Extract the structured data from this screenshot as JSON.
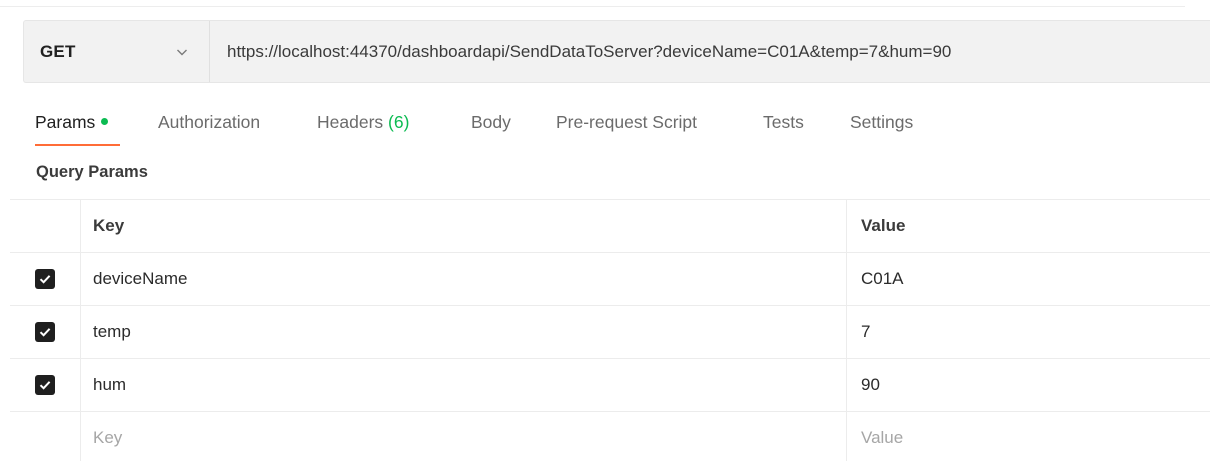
{
  "request": {
    "method": "GET",
    "url": "https://localhost:44370/dashboardapi/SendDataToServer?deviceName=C01A&temp=7&hum=90"
  },
  "tabs": [
    {
      "label": "Params",
      "active": true,
      "indicator": "green-dot"
    },
    {
      "label": "Authorization"
    },
    {
      "label": "Headers",
      "count": "(6)"
    },
    {
      "label": "Body"
    },
    {
      "label": "Pre-request Script"
    },
    {
      "label": "Tests"
    },
    {
      "label": "Settings"
    }
  ],
  "query_params": {
    "title": "Query Params",
    "columns": {
      "key": "Key",
      "value": "Value"
    },
    "rows": [
      {
        "key": "deviceName",
        "value": "C01A",
        "checked": true
      },
      {
        "key": "temp",
        "value": "7",
        "checked": true
      },
      {
        "key": "hum",
        "value": "90",
        "checked": true
      }
    ],
    "placeholder": {
      "key": "Key",
      "value": "Value"
    }
  },
  "colors": {
    "accent": "#ff6c37",
    "indicator": "#0cbb52",
    "checkbox": "#1f1f1f"
  },
  "icons": {
    "method_dropdown": "chevron-down-icon",
    "row_checkbox": "checkmark-icon"
  }
}
